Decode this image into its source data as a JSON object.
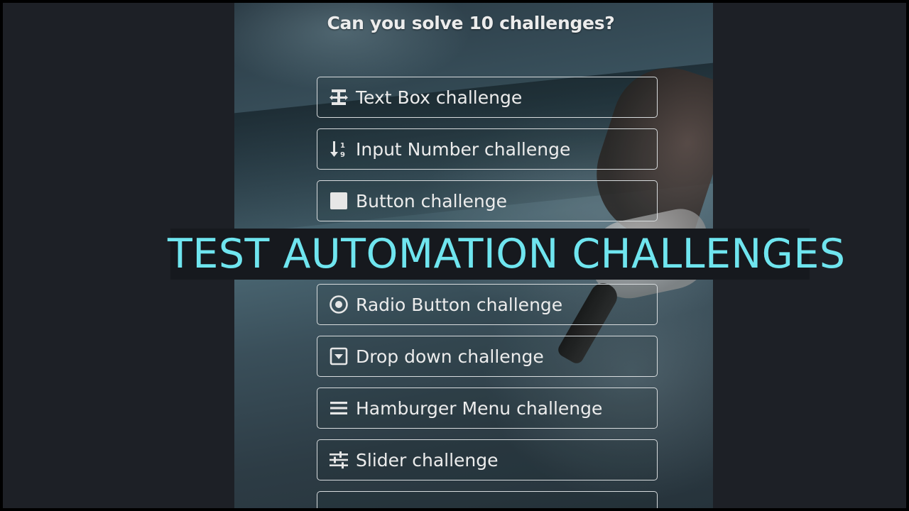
{
  "page": {
    "heading": "Can you solve 10 challenges?",
    "banner_title": "TEST AUTOMATION CHALLENGES"
  },
  "challenges": [
    {
      "label": "Text Box challenge",
      "icon": "text-box-icon"
    },
    {
      "label": "Input Number challenge",
      "icon": "sort-numeric-icon"
    },
    {
      "label": "Button challenge",
      "icon": "square-icon"
    },
    {
      "label": "Radio Button challenge",
      "icon": "radio-button-icon"
    },
    {
      "label": "Drop down challenge",
      "icon": "dropdown-box-icon"
    },
    {
      "label": "Hamburger Menu challenge",
      "icon": "hamburger-menu-icon"
    },
    {
      "label": "Slider challenge",
      "icon": "sliders-icon"
    }
  ],
  "colors": {
    "background": "#1d2026",
    "banner_text": "#6fe5ef",
    "button_border": "#d8dcde",
    "text": "#ececec"
  }
}
